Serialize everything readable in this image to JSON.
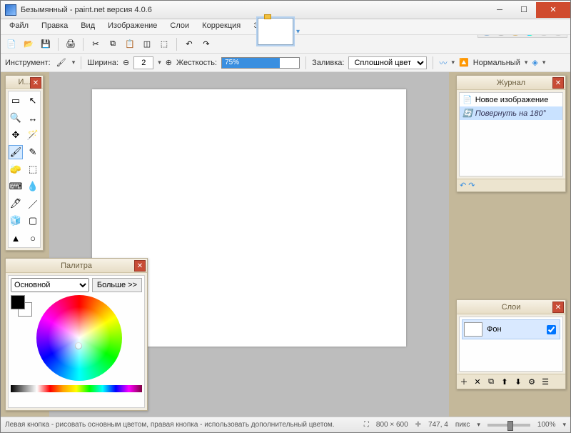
{
  "window": {
    "title": "Безымянный - paint.net версия 4.0.6",
    "min_icon": "─",
    "max_icon": "☐",
    "close_icon": "✕"
  },
  "menu": {
    "items": [
      "Файл",
      "Правка",
      "Вид",
      "Изображение",
      "Слои",
      "Коррекция",
      "Эффекты"
    ]
  },
  "toolbar1": {
    "icons": [
      "new",
      "open",
      "save",
      "print",
      "cut",
      "copy",
      "paste",
      "crop",
      "deselect",
      "undo",
      "redo"
    ]
  },
  "toolbar2": {
    "tool_label": "Инструмент:",
    "width_label": "Ширина:",
    "width_value": "2",
    "hardness_label": "Жесткость:",
    "hardness_value": "75%",
    "fill_label": "Заливка:",
    "fill_value": "Сплошной цвет",
    "blend_label": "Нормальный"
  },
  "panels": {
    "tools": {
      "title": "И...",
      "tools": [
        "▭",
        "↖",
        "🔍",
        "↔",
        "✥",
        "🪄",
        "🖌",
        "✎",
        "🧽",
        "⬚",
        "⌨",
        "💧",
        "🖊",
        "／",
        "🧊",
        "▢",
        "▲",
        "○"
      ]
    },
    "history": {
      "title": "Журнал",
      "items": [
        {
          "label": "Новое изображение",
          "selected": false
        },
        {
          "label": "Повернуть на 180°",
          "selected": true
        }
      ],
      "undo_icon": "↶",
      "redo_icon": "↷"
    },
    "palette": {
      "title": "Палитра",
      "mode": "Основной",
      "more": "Больше >>"
    },
    "layers": {
      "title": "Слои",
      "layer_name": "Фон",
      "layer_visible": true,
      "bottom_icons": [
        "＋",
        "✕",
        "⧉",
        "⬆",
        "⬇",
        "⚙",
        "☰"
      ]
    }
  },
  "status": {
    "hint": "Левая кнопка - рисовать основным цветом, правая кнопка - использовать дополнительный цветом.",
    "size": "800 × 600",
    "cursor": "747, 4",
    "unit": "пикс",
    "zoom": "100%"
  }
}
